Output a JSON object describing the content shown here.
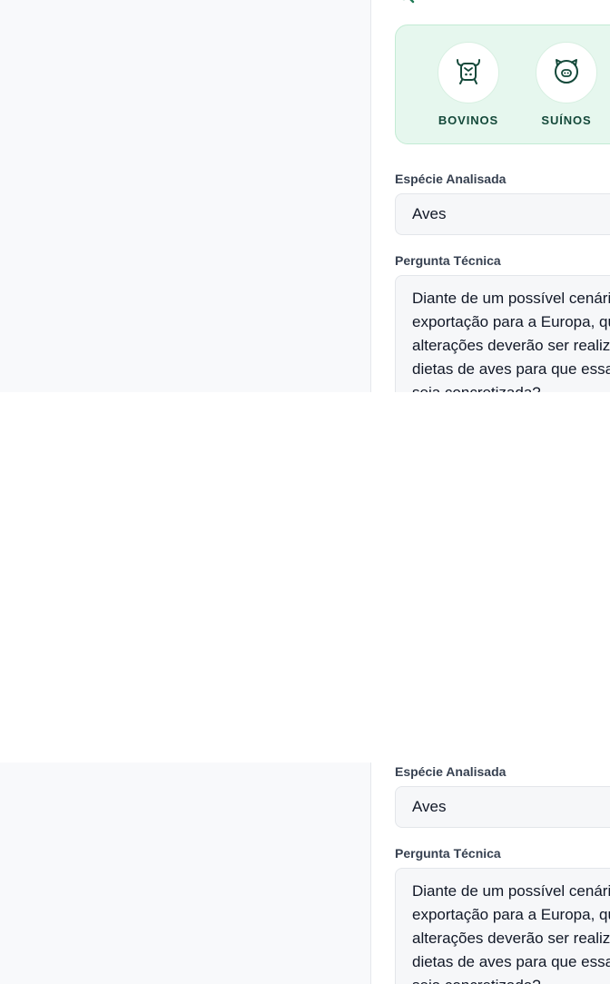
{
  "species_picker": {
    "items": [
      {
        "label": "BOVINOS",
        "icon": "cow-icon"
      },
      {
        "label": "SUÍNOS",
        "icon": "pig-icon"
      }
    ]
  },
  "form": {
    "species_label": "Espécie Analisada",
    "species_value": "Aves",
    "question_label": "Pergunta Técnica",
    "question_lines": [
      "Diante de um possível cenário de",
      "exportação para a Europa, que",
      "alterações deverão ser realizadas nas",
      "dietas de aves para que essa exportação",
      "seja concretizada?"
    ]
  },
  "colors": {
    "accent_green": "#1f7a55",
    "card_bg": "#e6f7ee",
    "label_dark": "#14493a"
  }
}
